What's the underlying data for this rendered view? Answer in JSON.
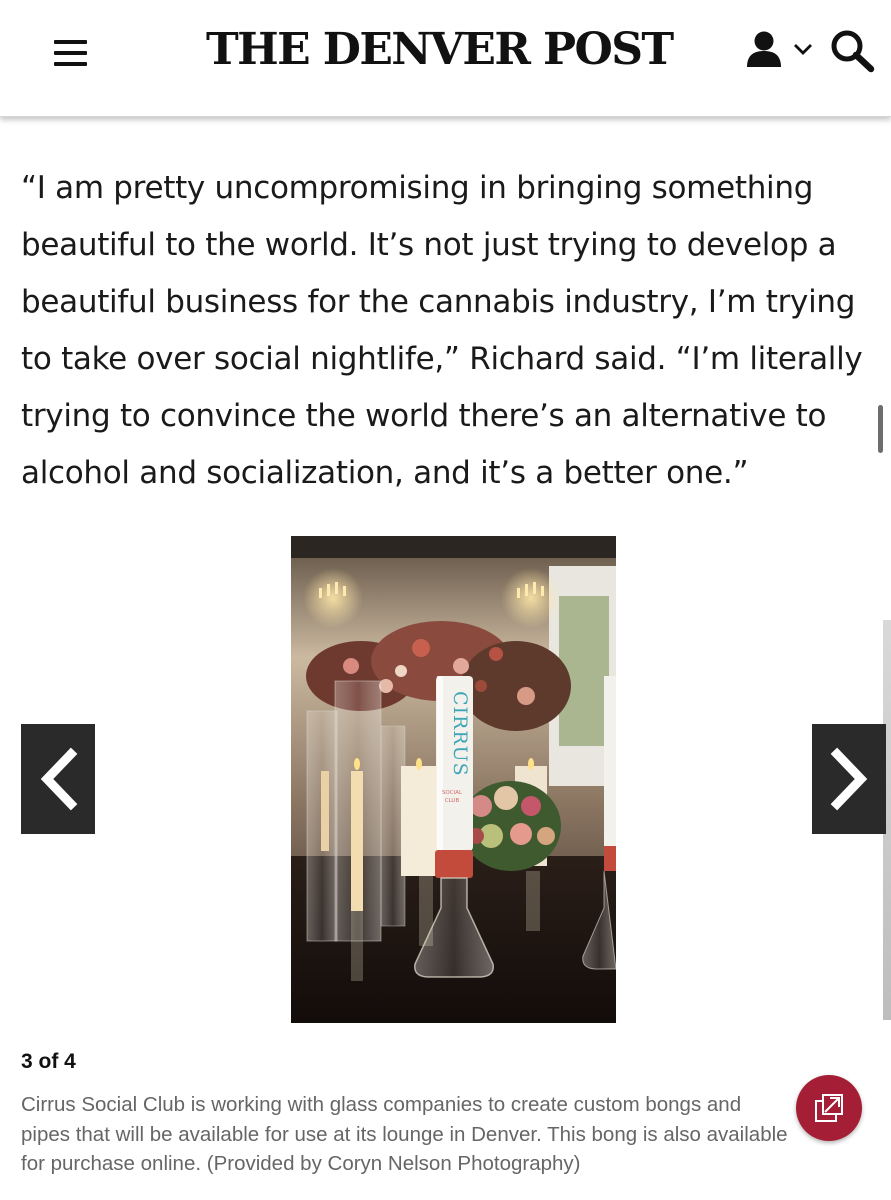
{
  "header": {
    "logo_text": "THE DENVER POST",
    "menu_icon": "hamburger-menu-icon",
    "account_icon": "user-icon",
    "account_chevron_icon": "chevron-down-icon",
    "search_icon": "search-icon"
  },
  "article": {
    "quote": "“I am pretty uncompromising in bringing something beautiful to the world. It’s not just trying to develop a beautiful business for the cannabis industry, I’m trying to take over social nightlife,” Richard said. “I’m literally trying to convince the world there’s an alternative to alcohol and socialization, and it’s a better one.”"
  },
  "gallery": {
    "counter": "3 of 4",
    "caption": "Cirrus Social Club is working with glass companies to create custom bongs and pipes that will be available for use at its lounge in Denver. This bong is also available for purchase online. (Provided by Coryn Nelson Photography)",
    "photo_text": {
      "bong_brand": "CIRRUS",
      "bong_sub_1": "SOCIAL",
      "bong_sub_2": "CLUB"
    },
    "prev_icon": "chevron-left-icon",
    "next_icon": "chevron-right-icon",
    "share_icon": "external-link-icon"
  },
  "colors": {
    "share_button": "#a41f35",
    "nav_arrow_bg": "#2a2a2a",
    "caption_text": "#666666",
    "body_text": "#1a1a1a"
  }
}
